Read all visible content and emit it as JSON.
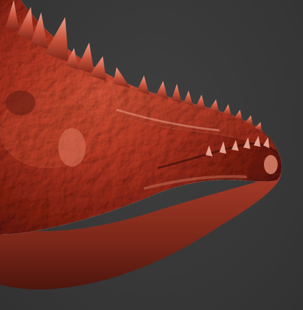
{
  "scene": {
    "background_color": "#383838",
    "subject": "sculpted-creature-head",
    "material_base_color": "#b8402f",
    "material_highlight_color": "#e07a5e",
    "material_shadow_color": "#5a1a12"
  }
}
